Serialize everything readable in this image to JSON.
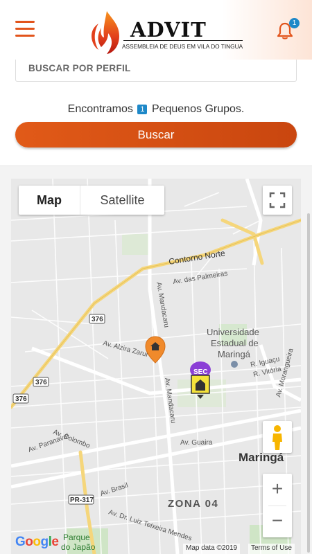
{
  "header": {
    "logo": {
      "title": "ADVIT",
      "subtitle": "ASSEMBLEIA DE DEUS EM VILA DO TINGUA"
    },
    "notification_count": "1",
    "accent_color": "#e2541b"
  },
  "search": {
    "placeholder": "BUSCAR POR PERFIL",
    "result_prefix": "Encontramos",
    "result_count": "1",
    "result_suffix": "Pequenos Grupos.",
    "button_label": "Buscar"
  },
  "map": {
    "map_type": {
      "map_label": "Map",
      "satellite_label": "Satellite",
      "selected": "Map"
    },
    "zoom_in_label": "+",
    "zoom_out_label": "−",
    "place_labels": {
      "contorno_norte": "Contorno Norte",
      "palmeiras": "Av. das Palmeiras",
      "mandacaru_1": "Av. Mandacaru",
      "mandacaru_2": "Av. Mandacaru",
      "uni_1": "Universidade",
      "uni_2": "Estadual de",
      "uni_3": "Maringá",
      "alzira": "Av. Alzira Zarur",
      "iguacu": "R. Iguaçu",
      "vitoria": "R. Vitória",
      "morangueira": "Av. Morangueira",
      "colombo": "Av. Colombo",
      "paranavai": "Av. Paranavaí",
      "guaira": "Av. Guaira",
      "brasil": "Av. Brasil",
      "luiz": "Av. Dr. Luiz Teixeira Mendes",
      "maringa": "Maringá",
      "zona": "ZONA 04",
      "parque_1": "Parque",
      "parque_2": "do Japão",
      "r376_a": "376",
      "r376_b": "376",
      "r376_c": "376",
      "pr317": "PR-317",
      "sec": "SEC"
    },
    "attribution": {
      "map_data": "Map data ©2019",
      "terms": "Terms of Use",
      "google": "Google"
    }
  }
}
